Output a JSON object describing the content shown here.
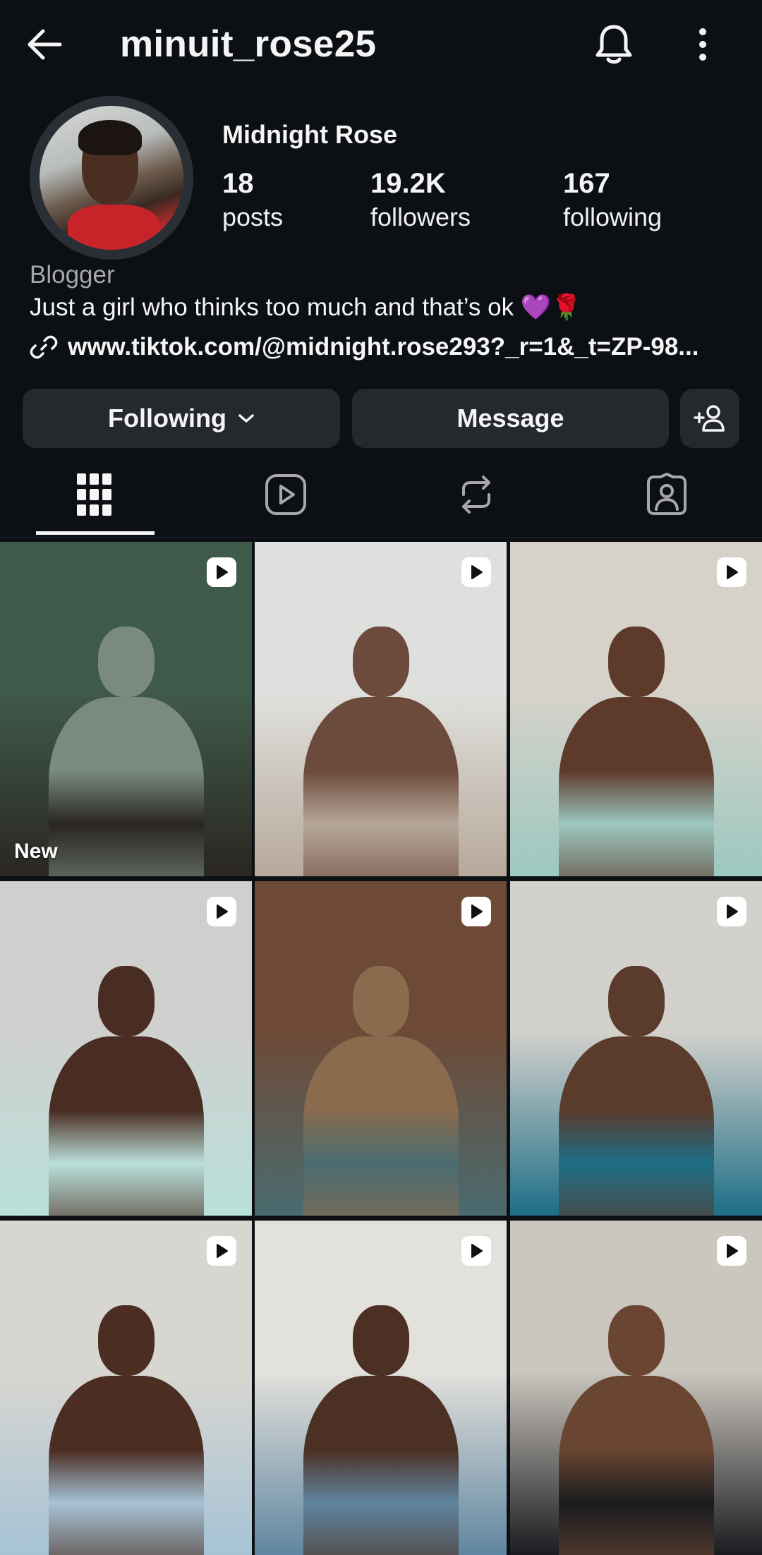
{
  "header": {
    "username": "minuit_rose25"
  },
  "profile": {
    "display_name": "Midnight Rose",
    "stats": [
      {
        "value": "18",
        "label": "posts"
      },
      {
        "value": "19.2K",
        "label": "followers"
      },
      {
        "value": "167",
        "label": "following"
      }
    ],
    "category": "Blogger",
    "bio": "Just a girl who thinks too much and that’s ok 💜🌹",
    "link": "www.tiktok.com/@midnight.rose293?_r=1&_t=ZP-98..."
  },
  "actions": {
    "following_label": "Following",
    "message_label": "Message"
  },
  "tabs": [
    "grid-icon",
    "reels-icon",
    "reposts-icon",
    "tagged-icon"
  ],
  "posts": [
    {
      "badge": "New",
      "type": "reel",
      "colors": [
        "#3f5a4a",
        "#2a2622",
        "#7a8a80"
      ]
    },
    {
      "type": "reel",
      "colors": [
        "#dfe0dd",
        "#b7a89a",
        "#6d4b3c"
      ]
    },
    {
      "type": "reel",
      "colors": [
        "#d6d2ca",
        "#9cc8c0",
        "#5e3a2b"
      ]
    },
    {
      "type": "reel",
      "colors": [
        "#cfd0ce",
        "#b9e0da",
        "#4a2d22"
      ]
    },
    {
      "type": "reel",
      "colors": [
        "#6e4a36",
        "#4a6b70",
        "#8a6b4e"
      ]
    },
    {
      "type": "reel",
      "colors": [
        "#d3d1cc",
        "#1e6e86",
        "#5b3b2c"
      ]
    },
    {
      "type": "reel",
      "colors": [
        "#d8d6d0",
        "#a6c3d6",
        "#4b2d22"
      ]
    },
    {
      "type": "reel",
      "colors": [
        "#e3e1dc",
        "#5f86a0",
        "#4d3024"
      ]
    },
    {
      "type": "reel",
      "colors": [
        "#cbc6be",
        "#1b1c20",
        "#6a4632"
      ]
    }
  ]
}
